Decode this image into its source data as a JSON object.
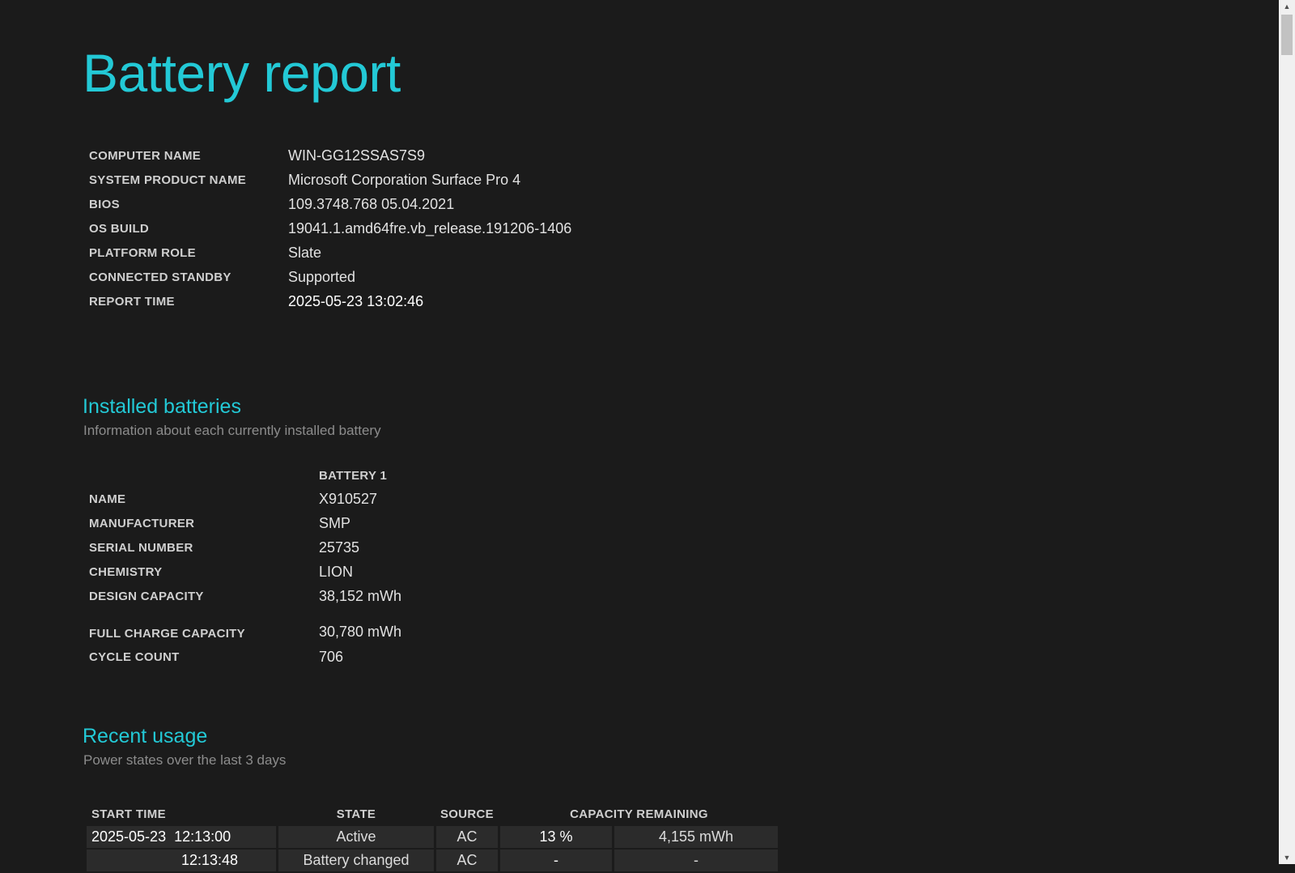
{
  "title": "Battery report",
  "system": [
    {
      "label": "COMPUTER NAME",
      "value": "WIN-GG12SSAS7S9"
    },
    {
      "label": "SYSTEM PRODUCT NAME",
      "value": "Microsoft Corporation Surface Pro 4"
    },
    {
      "label": "BIOS",
      "value": "109.3748.768 05.04.2021"
    },
    {
      "label": "OS BUILD",
      "value": "19041.1.amd64fre.vb_release.191206-1406"
    },
    {
      "label": "PLATFORM ROLE",
      "value": "Slate"
    },
    {
      "label": "CONNECTED STANDBY",
      "value": "Supported"
    },
    {
      "label": "REPORT TIME",
      "value": "2025-05-23  13:02:46"
    }
  ],
  "installed": {
    "heading": "Installed batteries",
    "subtitle": "Information about each currently installed battery",
    "column": "BATTERY 1",
    "rows": [
      {
        "label": "NAME",
        "value": "X910527"
      },
      {
        "label": "MANUFACTURER",
        "value": "SMP"
      },
      {
        "label": "SERIAL NUMBER",
        "value": "25735"
      },
      {
        "label": "CHEMISTRY",
        "value": "LION"
      },
      {
        "label": "DESIGN CAPACITY",
        "value": "38,152 mWh"
      },
      {
        "label": "FULL CHARGE CAPACITY",
        "value": "30,780 mWh"
      },
      {
        "label": "CYCLE COUNT",
        "value": "706"
      }
    ]
  },
  "usage": {
    "heading": "Recent usage",
    "subtitle": "Power states over the last 3 days",
    "headers": {
      "start": "START TIME",
      "state": "STATE",
      "source": "SOURCE",
      "capacity": "CAPACITY REMAINING"
    },
    "rows": [
      {
        "date": "2025-05-23",
        "time": "12:13:00",
        "state": "Active",
        "source": "AC",
        "pct": "13 %",
        "mwh": "4,155 mWh"
      },
      {
        "date": "",
        "time": "12:13:48",
        "state": "Battery changed",
        "source": "AC",
        "pct": "-",
        "mwh": "-"
      }
    ]
  },
  "scrollbar": {
    "up_glyph": "▲",
    "down_glyph": "▼"
  }
}
